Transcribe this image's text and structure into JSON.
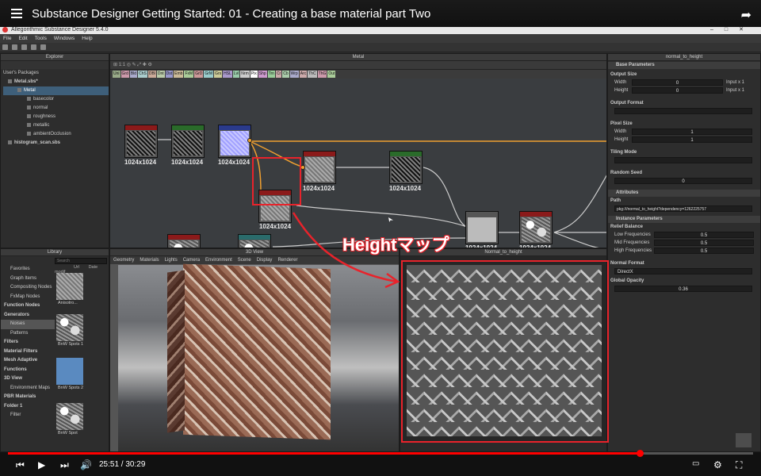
{
  "video": {
    "title": "Substance Designer Getting Started: 01 - Creating a base material part Two",
    "current_time": "25:51",
    "duration": "30:29",
    "time_sep": " / ",
    "progress": 0.848
  },
  "app": {
    "title": "Allegorithmic Substance Designer 5.4.0",
    "menu": [
      "File",
      "Edit",
      "Tools",
      "Windows",
      "Help"
    ]
  },
  "explorer": {
    "title": "Explorer",
    "root": "User's Packages",
    "items": [
      {
        "label": "Metal.sbs*",
        "bold": true
      },
      {
        "label": "Metal",
        "selected": true
      },
      {
        "label": "basecolor"
      },
      {
        "label": "normal"
      },
      {
        "label": "roughness"
      },
      {
        "label": "metallic"
      },
      {
        "label": "ambientOcclusion"
      },
      {
        "label": "histogram_scan.sbs",
        "bold": true
      }
    ]
  },
  "graph": {
    "title": "Metal",
    "tags": [
      "Uni",
      "Grd",
      "Bld",
      "ChS",
      "DBl",
      "Dnt",
      "Dst",
      "Emb",
      "FxM",
      "GrD",
      "GrM",
      "Grs",
      "HSL",
      "Lvl",
      "Nrm",
      "Pix",
      "Shp",
      "Trn",
      "Cr",
      "Cb",
      "Wrp",
      "Arc",
      "ThC",
      "ThG",
      "Out"
    ],
    "resolution": "1024x1024"
  },
  "library": {
    "title": "Library",
    "search_placeholder": "Search",
    "col_url": "Url",
    "col_date": "Date modif",
    "items": [
      {
        "label": "Favorites"
      },
      {
        "label": "Graph Items"
      },
      {
        "label": "Compositing Nodes"
      },
      {
        "label": "FxMap Nodes"
      },
      {
        "label": "Function Nodes",
        "bold": true
      },
      {
        "label": "Generators",
        "bold": true
      },
      {
        "label": "Noises",
        "selected": true
      },
      {
        "label": "Patterns"
      },
      {
        "label": "Filters",
        "bold": true
      },
      {
        "label": "Material Filters",
        "bold": true
      },
      {
        "label": "Mesh Adaptive",
        "bold": true
      },
      {
        "label": "Functions",
        "bold": true
      },
      {
        "label": "3D View",
        "bold": true
      },
      {
        "label": "Environment Maps"
      },
      {
        "label": "PBR Materials",
        "bold": true
      },
      {
        "label": "Folder 1",
        "bold": true
      },
      {
        "label": "Filter"
      }
    ],
    "thumbs": [
      "Anisotro...",
      "BnW Spots 1",
      "BnW Spots 2",
      "BnW Spot"
    ]
  },
  "view3d": {
    "title": "3D View",
    "menu": [
      "Geometry",
      "Materials",
      "Lights",
      "Camera",
      "Environment",
      "Scene",
      "Display",
      "Renderer"
    ]
  },
  "view2d": {
    "title": "Normal_to_height"
  },
  "properties": {
    "title": "normal_to_height",
    "base_parameters": "Base Parameters",
    "output_size": "Output Size",
    "width": "Width",
    "height": "Height",
    "size_value": "0",
    "input_x1": "Input x 1",
    "output_format": "Output Format",
    "pixel_size": "Pixel Size",
    "px_width": "Width",
    "px_height": "Height",
    "px_value": "1",
    "tiling_mode": "Tiling Mode",
    "random_seed": "Random Seed",
    "seed_value": "0",
    "attributes": "Attributes",
    "path_label": "Path",
    "path_value": "pkg:///normal_to_height?dependency=1262225757",
    "instance_parameters": "Instance Parameters",
    "relief_balance": "Relief Balance",
    "low_freq": "Low Frequencies",
    "mid_freq": "Mid Frequencies",
    "high_freq": "High Frequencies",
    "freq_value": "0.5",
    "normal_format": "Normal Format",
    "normal_format_value": "DirectX",
    "global_opacity": "Global Opacity",
    "global_opacity_value": "0.36"
  },
  "annotation": {
    "label": "Heightマップ",
    "color": "#e8232b"
  }
}
